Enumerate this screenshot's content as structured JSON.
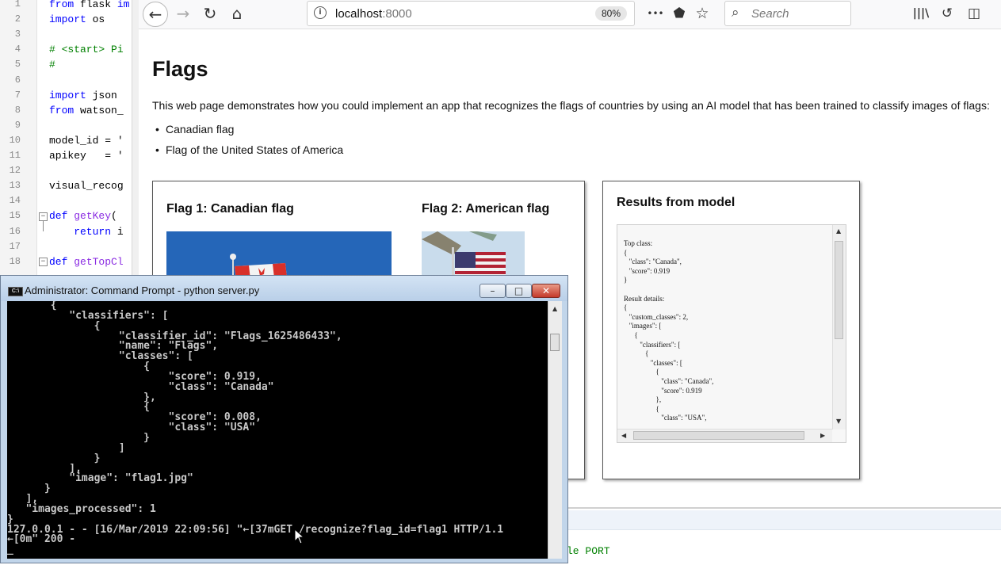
{
  "editor": {
    "line_numbers": [
      "1",
      "2",
      "3",
      "4",
      "5",
      "6",
      "7",
      "8",
      "9",
      "10",
      "11",
      "12",
      "13",
      "14",
      "15",
      "16",
      "17",
      "18"
    ],
    "lines": [
      [
        {
          "t": "from",
          "c": "kw"
        },
        {
          "t": " flask ",
          "c": ""
        },
        {
          "t": "im",
          "c": "kw"
        }
      ],
      [
        {
          "t": "import",
          "c": "kw"
        },
        {
          "t": " os",
          "c": ""
        }
      ],
      [],
      [
        {
          "t": "# <start> Pi",
          "c": "cm"
        }
      ],
      [
        {
          "t": "#",
          "c": "cm"
        }
      ],
      [],
      [
        {
          "t": "import",
          "c": "kw"
        },
        {
          "t": " json",
          "c": ""
        }
      ],
      [
        {
          "t": "from",
          "c": "kw"
        },
        {
          "t": " watson_",
          "c": ""
        }
      ],
      [],
      [
        {
          "t": "model_id = '",
          "c": ""
        }
      ],
      [
        {
          "t": "apikey   = '",
          "c": ""
        }
      ],
      [],
      [
        {
          "t": "visual_recog",
          "c": ""
        }
      ],
      [],
      [
        {
          "t": "def",
          "c": "kw"
        },
        {
          "t": " ",
          "c": ""
        },
        {
          "t": "getKey",
          "c": "fn"
        },
        {
          "t": "( ",
          "c": ""
        }
      ],
      [
        {
          "t": "    return",
          "c": "kw"
        },
        {
          "t": " i",
          "c": ""
        }
      ],
      [],
      [
        {
          "t": "def",
          "c": "kw"
        },
        {
          "t": " ",
          "c": ""
        },
        {
          "t": "getTopCl",
          "c": "fn"
        }
      ]
    ]
  },
  "browser": {
    "nav_back": "←",
    "nav_forward": "→",
    "nav_reload": "↻",
    "nav_home": "⌂",
    "url_host": "localhost",
    "url_port": ":8000",
    "zoom": "80%",
    "search_placeholder": "Search",
    "icons": {
      "info": "i",
      "more": "•••",
      "pocket": "⬟",
      "bookmark": "☆",
      "search": "⌕",
      "library": "|||\\",
      "sync": "↺",
      "sidebar": "◫"
    }
  },
  "page": {
    "title": "Flags",
    "intro": "This web page demonstrates how you could implement an app that recognizes the flags of countries by using an AI model that has been trained to classify images of flags:",
    "flags": [
      "Canadian flag",
      "Flag of the United States of America"
    ],
    "flag1_heading": "Flag 1: Canadian flag",
    "flag2_heading": "Flag 2: American flag",
    "results_title": "Results from model",
    "results_text": "Top class:\n{\n   \"class\": \"Canada\",\n   \"score\": 0.919\n}\n\nResult details:\n{\n   \"custom_classes\": 2,\n   \"images\": [\n      {\n         \"classifiers\": [\n            {\n               \"classes\": [\n                  {\n                     \"class\": \"Canada\",\n                     \"score\": 0.919\n                  },\n                  {\n                     \"class\": \"USA\","
  },
  "bottom": {
    "code_fragment": "le PORT"
  },
  "cmd": {
    "title": "Administrator: Command Prompt - python  server.py",
    "icon_label": "C:\\",
    "min_label": "–",
    "max_label": "□",
    "close_label": "✕",
    "output": "       {\n          \"classifiers\": [\n              {\n                  \"classifier_id\": \"Flags_1625486433\",\n                  \"name\": \"Flags\",\n                  \"classes\": [\n                      {\n                          \"score\": 0.919,\n                          \"class\": \"Canada\"\n                      },\n                      {\n                          \"score\": 0.008,\n                          \"class\": \"USA\"\n                      }\n                  ]\n              }\n          ],\n          \"image\": \"flag1.jpg\"\n      }\n   ],\n   \"images_processed\": 1\n}\n127.0.0.1 - - [16/Mar/2019 22:09:56] \"←[37mGET /recognize?flag_id=flag1 HTTP/1.1\n←[0m\" 200 -\n_"
  },
  "colors": {
    "console_bg": "#000000",
    "console_text": "#c8c8c8",
    "titlebar": "#c1d5ea",
    "close_button": "#c4392a",
    "code_keyword": "#0000ff",
    "code_comment": "#008000"
  }
}
